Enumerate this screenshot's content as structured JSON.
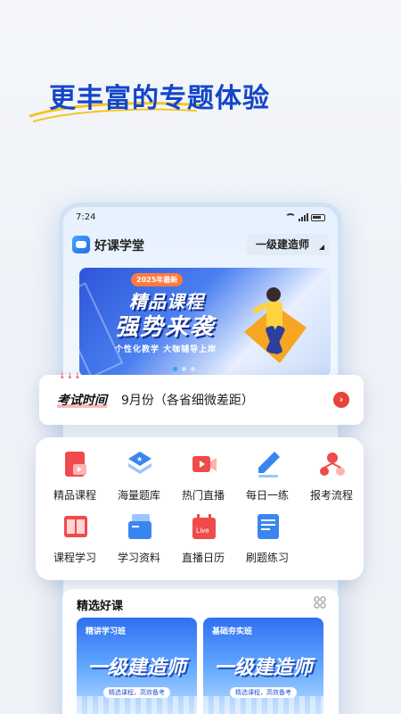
{
  "headline": "更丰富的专题体验",
  "status_bar": {
    "time": "7:24"
  },
  "app": {
    "name": "好课学堂",
    "exam_select": "一级建造师"
  },
  "banner": {
    "badge": "2025年最新",
    "title_line1": "精品课程",
    "title_line2": "强势来袭",
    "subtitle": "个性化教学   大咖辅导上岸"
  },
  "exam_time": {
    "label": "考试时间",
    "value": "9月份（各省细微差距）",
    "arrows": "↓↓↓"
  },
  "grid": {
    "row1": [
      {
        "label": "精品课程",
        "icon": "video-book-icon",
        "color": "#ef4b4b"
      },
      {
        "label": "海量题库",
        "icon": "layers-star-icon",
        "color": "#3a86f0"
      },
      {
        "label": "热门直播",
        "icon": "video-camera-icon",
        "color": "#ef4b4b"
      },
      {
        "label": "每日一练",
        "icon": "pencil-icon",
        "color": "#3a86f0"
      },
      {
        "label": "报考流程",
        "icon": "flow-icon",
        "color": "#ef4b4b"
      }
    ],
    "row2": [
      {
        "label": "课程学习",
        "icon": "open-book-icon",
        "color": "#ef4b4b"
      },
      {
        "label": "学习资料",
        "icon": "folder-icon",
        "color": "#3a86f0"
      },
      {
        "label": "直播日历",
        "icon": "calendar-live-icon",
        "color": "#ef4b4b"
      },
      {
        "label": "刷题练习",
        "icon": "clipboard-icon",
        "color": "#3a86f0"
      }
    ]
  },
  "featured": {
    "title": "精选好课",
    "courses": [
      {
        "tag": "精讲学习班",
        "main": "一级建造师",
        "sub": "精选课程，高效备考"
      },
      {
        "tag": "基础夯实班",
        "main": "一级建造师",
        "sub": "精选课程，高效备考"
      }
    ]
  },
  "colors": {
    "brand": "#1446c8",
    "accent_red": "#e8423a",
    "accent_blue": "#3a86f0"
  }
}
